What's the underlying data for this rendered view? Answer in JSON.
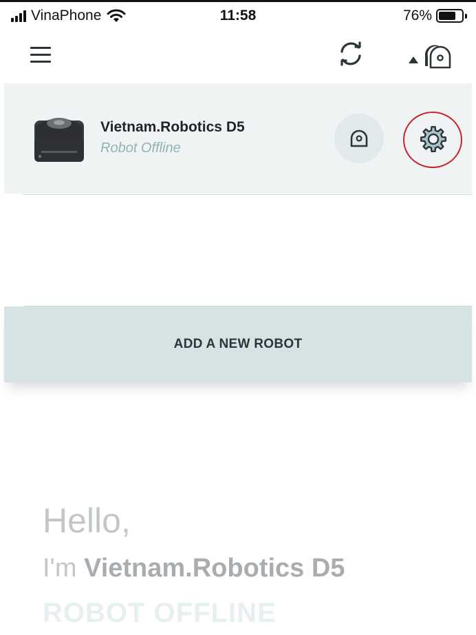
{
  "status_bar": {
    "carrier": "VinaPhone",
    "time": "11:58",
    "battery_percent": "76%",
    "battery_level": 0.76
  },
  "header": {
    "menu_icon": "hamburger-menu-icon",
    "sync_icon": "sync-icon",
    "robot_switch_icon": "robot-switch-icon"
  },
  "robot_card": {
    "name": "Vietnam.Robotics D5",
    "status": "Robot Offline",
    "action_icon": "robot-icon",
    "settings_icon": "gear-icon"
  },
  "add_robot": {
    "label": "ADD A NEW ROBOT"
  },
  "greeting": {
    "hello": "Hello,",
    "prefix": "I'm",
    "robot_name": "Vietnam.Robotics D5",
    "status": "ROBOT OFFLINE"
  },
  "colors": {
    "card_background": "#eff3f3",
    "add_button_background": "#d6e3e5",
    "status_text": "#8fb4b6",
    "highlight_circle": "#c8242d"
  }
}
